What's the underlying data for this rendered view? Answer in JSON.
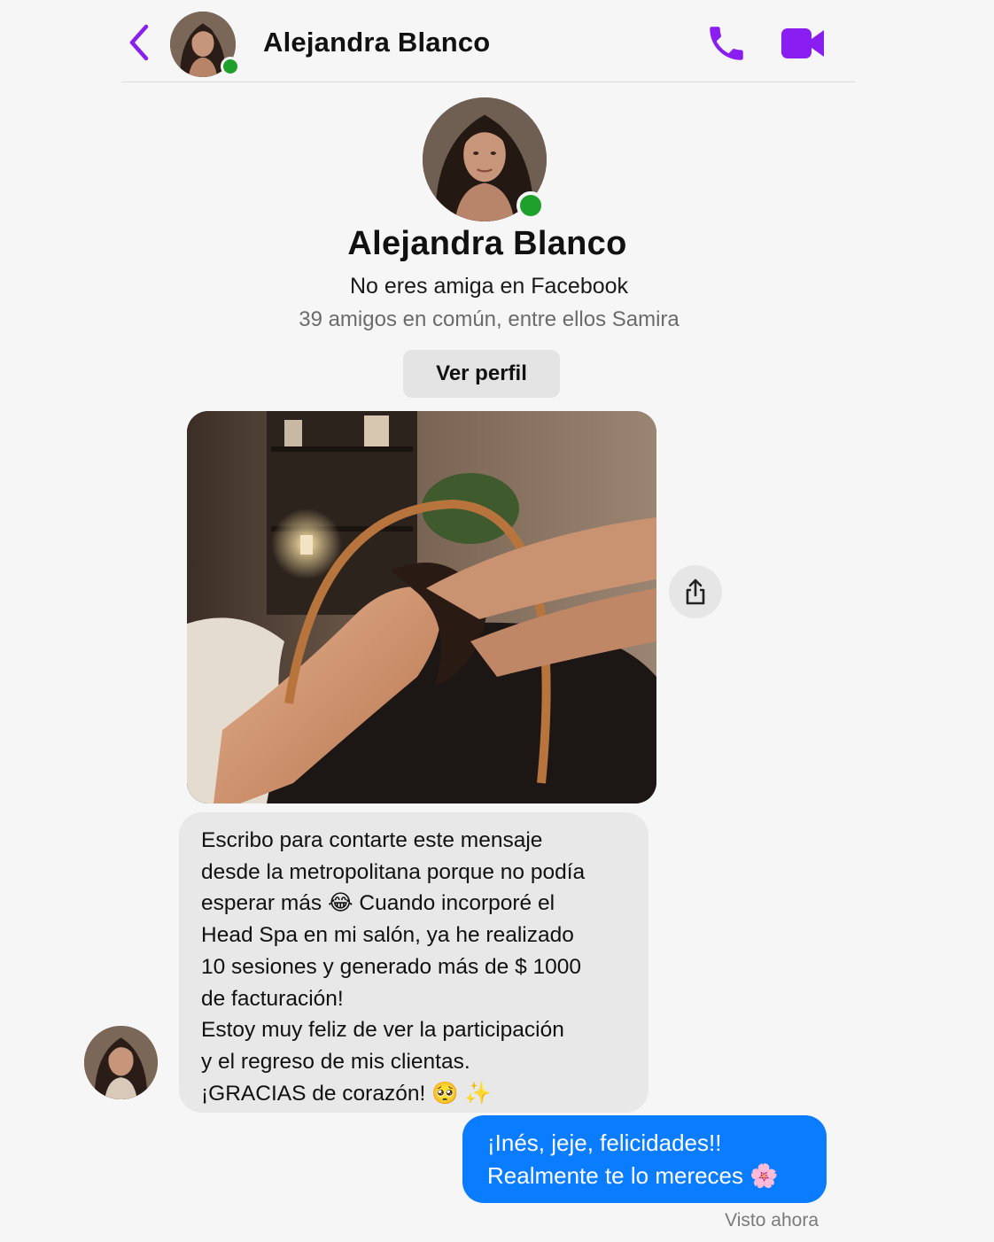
{
  "header": {
    "name": "Alejandra Blanco",
    "back_icon": "chevron-left-icon",
    "call_icon": "phone-icon",
    "video_icon": "video-camera-icon",
    "accent_color": "#8a1ef0",
    "online": true
  },
  "profile": {
    "name": "Alejandra Blanco",
    "friend_status": "No eres amiga en Facebook",
    "mutual_friends": "39 amigos en común, entre ellos Samira",
    "view_profile_label": "Ver perfil"
  },
  "messages": {
    "photo": {
      "share_icon": "share-icon"
    },
    "incoming_lines": [
      "Escribo para contarte este mensaje",
      "desde la metropolitana porque no podía",
      "esperar más 😂 Cuando incorporé el",
      "Head Spa en mi salón, ya he realizado",
      "10 sesiones y generado más de $ 1000",
      "de facturación!",
      "Estoy muy feliz de ver la participación",
      "y el regreso de mis clientas.",
      "¡GRACIAS de corazón! 🥺 ✨"
    ],
    "outgoing_lines": [
      "¡Inés, jeje, felicidades!!",
      "Realmente te lo mereces 🌸"
    ],
    "outgoing_color": "#0a7cff",
    "seen_status": "Visto ahora"
  }
}
